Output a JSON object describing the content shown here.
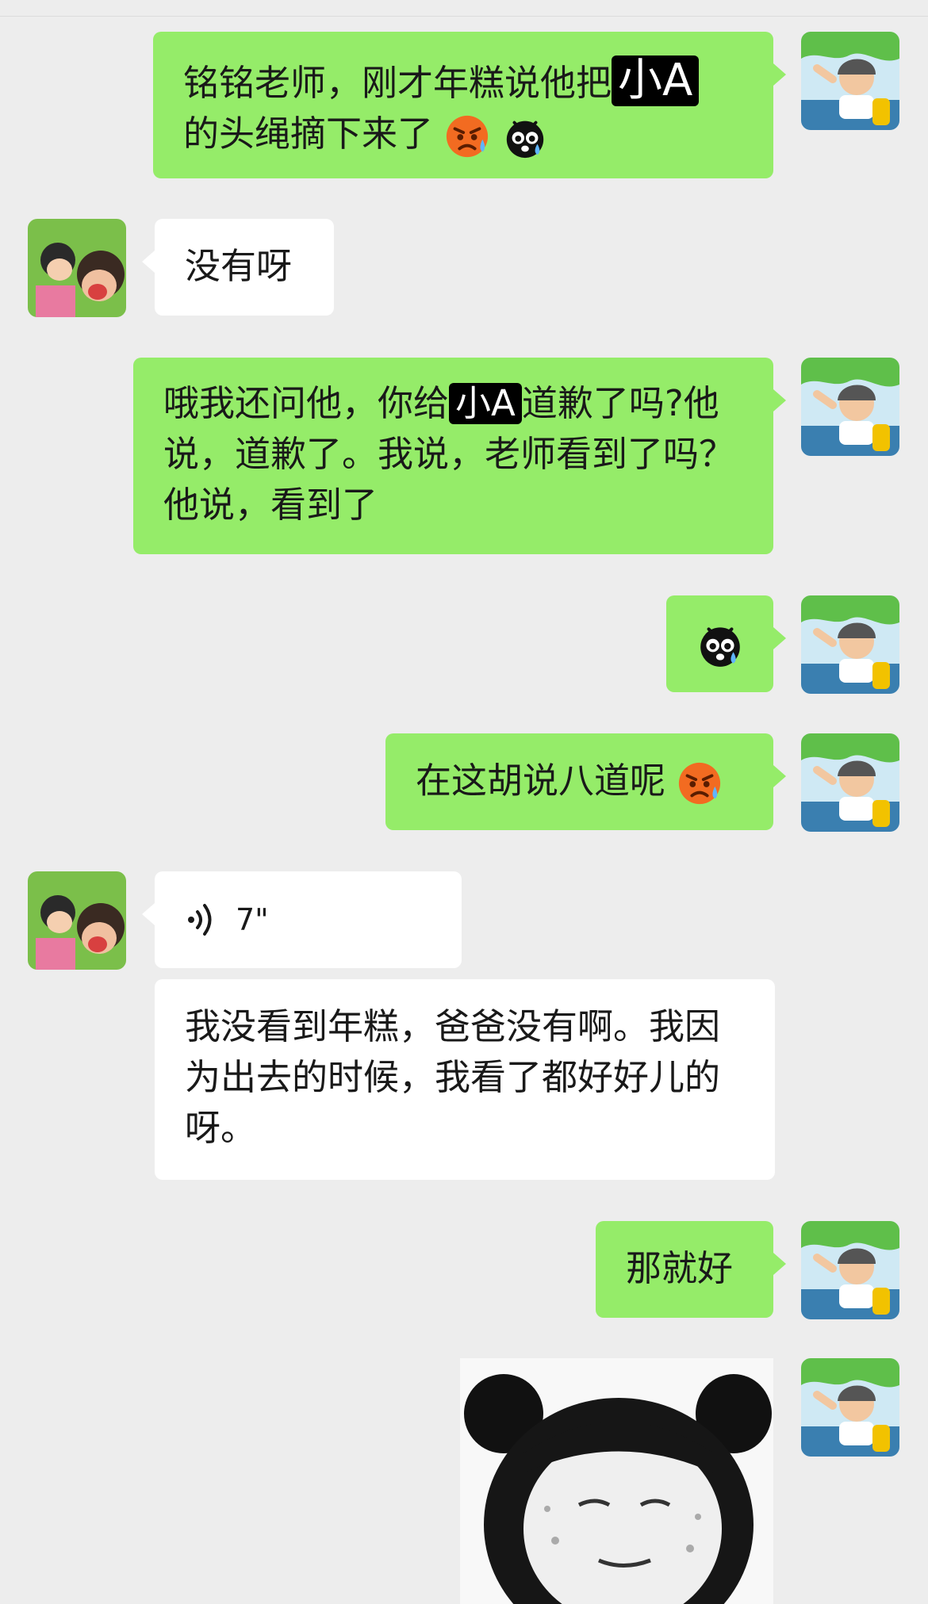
{
  "messages": [
    {
      "side": "me",
      "parts": [
        "铭铭老师，刚才年糕说他把",
        "小A",
        "的头绳摘下来了"
      ],
      "emojis": [
        "angry-sweat",
        "crying-bug"
      ]
    },
    {
      "side": "them",
      "text": "没有呀"
    },
    {
      "side": "me",
      "parts": [
        "哦我还问他，你给",
        "小A",
        "道歉了吗?他说，道歉了。我说，老师看到了吗？他说，看到了"
      ]
    },
    {
      "side": "me",
      "emojis": [
        "crying-bug"
      ]
    },
    {
      "side": "me",
      "text": "在这胡说八道呢",
      "emojis": [
        "angry-sweat"
      ]
    },
    {
      "side": "them",
      "voice_duration": "7\""
    },
    {
      "side": "them",
      "text": "我没看到年糕，爸爸没有啊。我因为出去的时候，我看了都好好儿的呀。"
    },
    {
      "side": "me",
      "text": "那就好"
    },
    {
      "side": "me",
      "sticker": "panda-meme-sticker"
    }
  ],
  "m1": {
    "a": "铭铭老师，刚才年糕说他把",
    "tag": "小A",
    "b": "的头绳摘下来了"
  },
  "m2": {
    "text": "没有呀"
  },
  "m3": {
    "a": "哦我还问他，你给",
    "tag": "小A",
    "b": "道歉了吗?他说，道歉了。我说，老师看到了吗？他说，看到了"
  },
  "m5": {
    "text": "在这胡说八道呢"
  },
  "m6": {
    "duration": "7\""
  },
  "m7": {
    "text": "我没看到年糕，爸爸没有啊。我因为出去的时候，我看了都好好儿的呀。"
  },
  "m8": {
    "text": "那就好"
  },
  "colors": {
    "me_bubble": "#95ec69",
    "them_bubble": "#ffffff",
    "background": "#ededed"
  }
}
